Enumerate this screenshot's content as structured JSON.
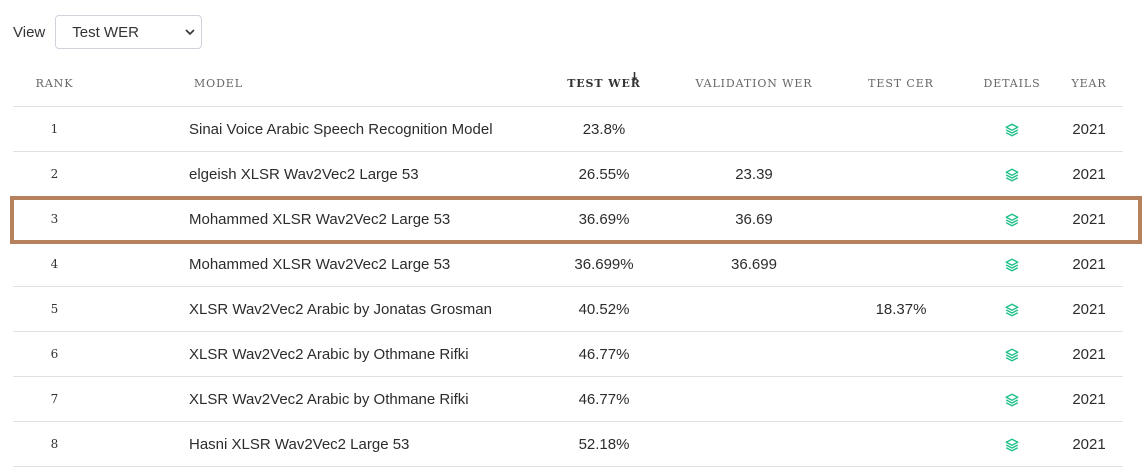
{
  "view": {
    "label": "View",
    "selected": "Test WER"
  },
  "table": {
    "headers": {
      "rank": "RANK",
      "model": "MODEL",
      "test_wer": "TEST WER",
      "validation_wer": "VALIDATION WER",
      "test_cer": "TEST CER",
      "details": "DETAILS",
      "year": "YEAR"
    },
    "sort_icon": "sort-down-arrow-icon",
    "details_icon": "layers-icon",
    "details_icon_color": "#21c08b",
    "highlight_color": "#b5825b",
    "highlighted_rank": "3",
    "rows": [
      {
        "rank": "1",
        "model": "Sinai Voice Arabic Speech Recognition Model",
        "test_wer": "23.8%",
        "validation_wer": "",
        "test_cer": "",
        "year": "2021"
      },
      {
        "rank": "2",
        "model": "elgeish XLSR Wav2Vec2 Large 53",
        "test_wer": "26.55%",
        "validation_wer": "23.39",
        "test_cer": "",
        "year": "2021"
      },
      {
        "rank": "3",
        "model": "Mohammed XLSR Wav2Vec2 Large 53",
        "test_wer": "36.69%",
        "validation_wer": "36.69",
        "test_cer": "",
        "year": "2021"
      },
      {
        "rank": "4",
        "model": "Mohammed XLSR Wav2Vec2 Large 53",
        "test_wer": "36.699%",
        "validation_wer": "36.699",
        "test_cer": "",
        "year": "2021"
      },
      {
        "rank": "5",
        "model": "XLSR Wav2Vec2 Arabic by Jonatas Grosman",
        "test_wer": "40.52%",
        "validation_wer": "",
        "test_cer": "18.37%",
        "year": "2021"
      },
      {
        "rank": "6",
        "model": "XLSR Wav2Vec2 Arabic by Othmane Rifki",
        "test_wer": "46.77%",
        "validation_wer": "",
        "test_cer": "",
        "year": "2021"
      },
      {
        "rank": "7",
        "model": "XLSR Wav2Vec2 Arabic by Othmane Rifki",
        "test_wer": "46.77%",
        "validation_wer": "",
        "test_cer": "",
        "year": "2021"
      },
      {
        "rank": "8",
        "model": "Hasni XLSR Wav2Vec2 Large 53",
        "test_wer": "52.18%",
        "validation_wer": "",
        "test_cer": "",
        "year": "2021"
      }
    ]
  }
}
